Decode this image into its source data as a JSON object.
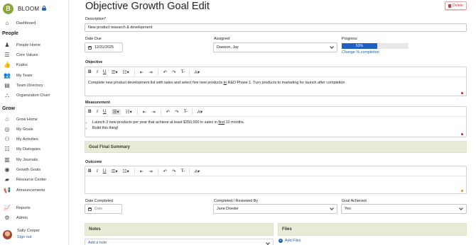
{
  "app": {
    "name": "BLOOM",
    "logo_letter": "B"
  },
  "sidebar": {
    "dashboard": "Dashboard",
    "people_section": "People",
    "people_items": [
      {
        "label": "People Home",
        "icon": "person-icon"
      },
      {
        "label": "Core Values",
        "icon": "list-icon"
      },
      {
        "label": "Kudos",
        "icon": "thumbs-up-icon"
      },
      {
        "label": "My Team",
        "icon": "team-icon"
      },
      {
        "label": "Team Directory",
        "icon": "contact-card-icon"
      },
      {
        "label": "Organization Chart",
        "icon": "org-chart-icon"
      }
    ],
    "grow_section": "Grow",
    "grow_items": [
      {
        "label": "Grow Home",
        "icon": "sprout-icon"
      },
      {
        "label": "My Goals",
        "icon": "target-icon"
      },
      {
        "label": "My Activities",
        "icon": "activities-icon"
      },
      {
        "label": "My Dialogues",
        "icon": "dialogue-icon"
      },
      {
        "label": "My Journals",
        "icon": "journal-icon"
      },
      {
        "label": "Growth Goals",
        "icon": "growth-target-icon"
      },
      {
        "label": "Resource Center",
        "icon": "folder-icon"
      },
      {
        "label": "Announcements",
        "icon": "megaphone-icon"
      }
    ],
    "reports": "Reports",
    "admin": "Admin",
    "user_name": "Sally Cooper",
    "sign_out": "Sign out"
  },
  "page": {
    "title": "Objective Growth Goal Edit",
    "delete_label": "Delete"
  },
  "form": {
    "description_label": "Description*",
    "description_value": "New product research & development",
    "date_due_label": "Date Due",
    "date_due_value": "12/31/2025",
    "assigned_label": "Assigned",
    "assigned_value": "Dawson, Jay",
    "progress_label": "Progress",
    "progress_value": "53%",
    "progress_fraction": 0.53,
    "change_completion": "Change % completion",
    "objective_label": "Objective",
    "objective_text_1": "Complete new product development list with sales and select five new products ",
    "objective_text_to": "to",
    "objective_text_2": " R&D Phase 1.  Turn products to marketing for launch after completion.",
    "measurement_label": "Measurement",
    "measurement_item_1a": "Launch 3 new products per year that achieve at least $350,000 in sales in ",
    "measurement_item_1b": "first",
    "measurement_item_1c": " 12 months.",
    "measurement_item_2": "Build this thing!",
    "summary_band": "Goal Final Summary",
    "outcome_label": "Outcome",
    "date_completed_label": "Date Completed",
    "date_completed_placeholder": "Date",
    "completed_by_label": "Completed / Reviewed By",
    "completed_by_value": "Jane Doeder",
    "goal_achieved_label": "Goal Achieved",
    "goal_achieved_value": "Yes",
    "notes_label": "Notes",
    "add_note": "Add a note",
    "files_label": "Files",
    "add_files": "Add Files"
  }
}
